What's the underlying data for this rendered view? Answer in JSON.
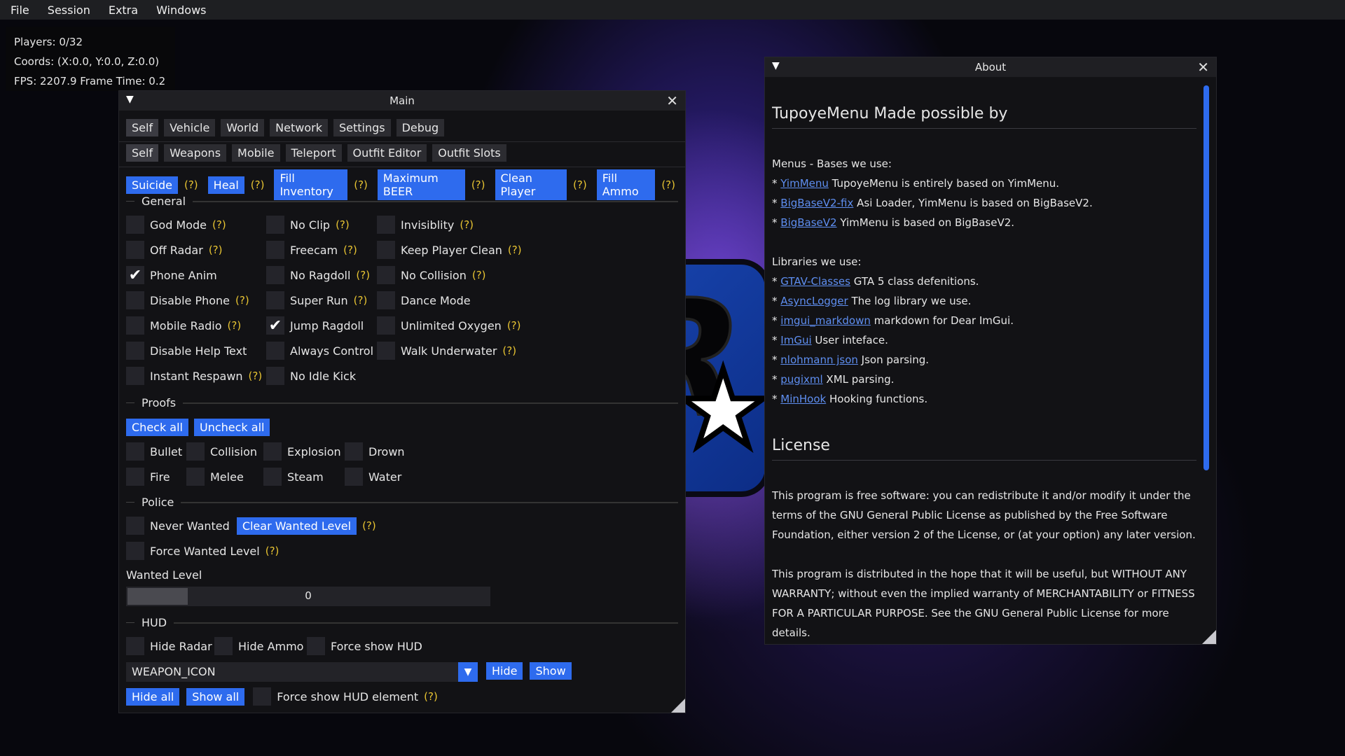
{
  "menubar": [
    "File",
    "Session",
    "Extra",
    "Windows"
  ],
  "stats": {
    "players": "Players: 0/32",
    "coords": "Coords: (X:0.0, Y:0.0, Z:0.0)",
    "fps": "FPS: 2207.9  Frame Time: 0.2"
  },
  "main": {
    "title": "Main",
    "tabs": [
      "Self",
      "Vehicle",
      "World",
      "Network",
      "Settings",
      "Debug"
    ],
    "subtabs": [
      "Self",
      "Weapons",
      "Mobile",
      "Teleport",
      "Outfit Editor",
      "Outfit Slots"
    ],
    "actions": [
      "Suicide",
      "Heal",
      "Fill Inventory",
      "Maximum BEER",
      "Clean Player",
      "Fill Ammo"
    ],
    "help": "(?)",
    "sections": {
      "general": "General",
      "proofs": "Proofs",
      "police": "Police",
      "hud": "HUD"
    },
    "general": {
      "col1": [
        {
          "label": "God Mode",
          "checked": false,
          "help": true
        },
        {
          "label": "Off Radar",
          "checked": false,
          "help": true
        },
        {
          "label": "Phone Anim",
          "checked": true,
          "help": false
        },
        {
          "label": "Disable Phone",
          "checked": false,
          "help": true
        },
        {
          "label": "Mobile Radio",
          "checked": false,
          "help": true
        },
        {
          "label": "Disable Help Text",
          "checked": false,
          "help": false
        },
        {
          "label": "Instant Respawn",
          "checked": false,
          "help": true
        }
      ],
      "col2": [
        {
          "label": "No Clip",
          "checked": false,
          "help": true
        },
        {
          "label": "Freecam",
          "checked": false,
          "help": true
        },
        {
          "label": "No Ragdoll",
          "checked": false,
          "help": true
        },
        {
          "label": "Super Run",
          "checked": false,
          "help": true
        },
        {
          "label": "Jump Ragdoll",
          "checked": true,
          "help": false
        },
        {
          "label": "Always Control",
          "checked": false,
          "help": false
        },
        {
          "label": "No Idle Kick",
          "checked": false,
          "help": false
        }
      ],
      "col3": [
        {
          "label": "Invisiblity",
          "checked": false,
          "help": true
        },
        {
          "label": "Keep Player Clean",
          "checked": false,
          "help": true
        },
        {
          "label": "No Collision",
          "checked": false,
          "help": true
        },
        {
          "label": "Dance Mode",
          "checked": false,
          "help": false
        },
        {
          "label": "Unlimited Oxygen",
          "checked": false,
          "help": true
        },
        {
          "label": "Walk Underwater",
          "checked": false,
          "help": true
        }
      ]
    },
    "proofs": {
      "check_all": "Check all",
      "uncheck_all": "Uncheck all",
      "items": [
        "Bullet",
        "Collision",
        "Explosion",
        "Drown",
        "Fire",
        "Melee",
        "Steam",
        "Water"
      ]
    },
    "police": {
      "never_wanted": "Never Wanted",
      "clear_wanted": "Clear Wanted Level",
      "force_wanted": "Force Wanted Level",
      "wanted_level_label": "Wanted Level",
      "wanted_level_value": "0"
    },
    "hud": {
      "hide_radar": "Hide Radar",
      "hide_ammo": "Hide Ammo",
      "force_show_hud": "Force show HUD",
      "element": "WEAPON_ICON",
      "hide": "Hide",
      "show": "Show",
      "hide_all": "Hide all",
      "show_all": "Show all",
      "force_show_element": "Force show HUD element"
    }
  },
  "about": {
    "title": "About",
    "heading": "TupoyeMenu Made possible by",
    "bases_title": "Menus - Bases we use:",
    "bases": [
      {
        "link": "YimMenu",
        "text": " TupoyeMenu is entirely based on YimMenu."
      },
      {
        "link": "BigBaseV2-fix",
        "text": " Asi Loader, YimMenu is based on BigBaseV2."
      },
      {
        "link": "BigBaseV2",
        "text": " YimMenu is based on BigBaseV2."
      }
    ],
    "libs_title": "Libraries we use:",
    "libs": [
      {
        "link": "GTAV-Classes",
        "text": " GTA 5 class defenitions."
      },
      {
        "link": "AsyncLogger",
        "text": " The log library we use."
      },
      {
        "link": "imgui_markdown",
        "text": " markdown for Dear ImGui."
      },
      {
        "link": "ImGui",
        "text": " User inteface."
      },
      {
        "link": "nlohmann json",
        "text": " Json parsing."
      },
      {
        "link": "pugixml",
        "text": " XML parsing."
      },
      {
        "link": "MinHook",
        "text": " Hooking functions."
      }
    ],
    "license_heading": "License",
    "license_p1": "This program is free software: you can redistribute it and/or modify it under the terms of the GNU General Public License as published by the Free Software Foundation, either version 2 of the License, or (at your option) any later version.",
    "license_p2": "This program is distributed in the hope that it will be useful, but WITHOUT ANY WARRANTY; without even the implied warranty of MERCHANTABILITY or FITNESS FOR A PARTICULAR PURPOSE. See the GNU General Public License for more details."
  },
  "colors": {
    "accent": "#2e6bee",
    "help": "#e8c432",
    "window_bg": "#121215"
  }
}
